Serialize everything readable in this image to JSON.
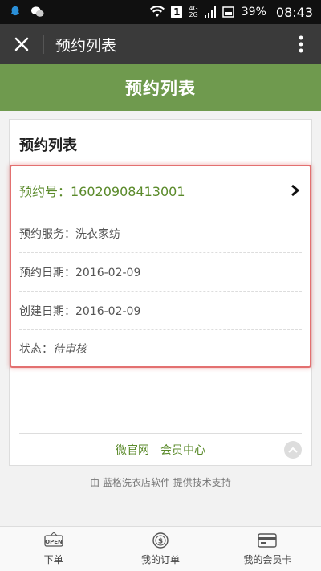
{
  "status_bar": {
    "sim": "1",
    "network_top": "4G",
    "network_bottom": "2G",
    "battery": "39%",
    "time": "08:43"
  },
  "nav": {
    "title": "预约列表"
  },
  "header": {
    "title": "预约列表"
  },
  "card": {
    "title": "预约列表",
    "order": {
      "number_label": "预约号：16020908413001",
      "service": "预约服务：洗衣家纺",
      "date": "预约日期：2016-02-09",
      "created": "创建日期：2016-02-09",
      "status_label": "状态：",
      "status_value": "待审核"
    },
    "footer_links": {
      "site": "微官网",
      "member": "会员中心"
    }
  },
  "support_text": "由  蓝格洗衣店软件  提供技术支持",
  "tabs": [
    {
      "label": "下单",
      "icon": "open-sign-icon"
    },
    {
      "label": "我的订单",
      "icon": "dollar-coin-icon"
    },
    {
      "label": "我的会员卡",
      "icon": "card-icon"
    }
  ],
  "colors": {
    "accent": "#6f9a4e",
    "link": "#5a8a2a",
    "highlight": "#e37070"
  }
}
